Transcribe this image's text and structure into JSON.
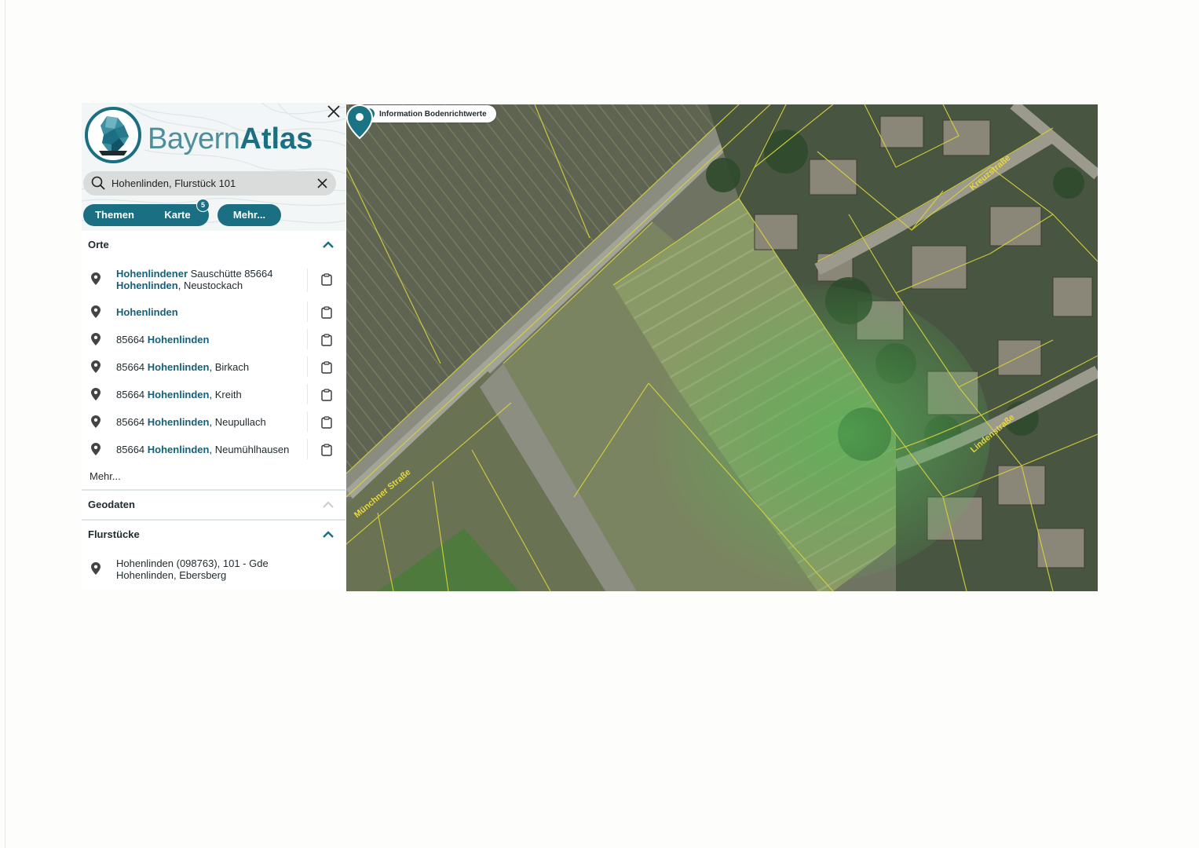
{
  "app": {
    "logo_light": "Bayern",
    "logo_bold": "Atlas"
  },
  "search": {
    "value": "Hohenlinden, Flurstück 101"
  },
  "tabs": [
    {
      "label": "Themen"
    },
    {
      "label": "Karte",
      "badge": "5"
    }
  ],
  "more_button": "Mehr...",
  "sections": {
    "orte": {
      "title": "Orte",
      "expanded": true,
      "results": [
        {
          "line1_bold": "Hohenlindener",
          "line1_rest": " Sauschütte 85664",
          "line2_bold": "Hohenlinden",
          "line2_rest": ", Neustockach"
        },
        {
          "prefix": "",
          "bold": "Hohenlinden",
          "rest": ""
        },
        {
          "prefix": "85664 ",
          "bold": "Hohenlinden",
          "rest": ""
        },
        {
          "prefix": "85664 ",
          "bold": "Hohenlinden",
          "rest": ", Birkach"
        },
        {
          "prefix": "85664 ",
          "bold": "Hohenlinden",
          "rest": ", Kreith"
        },
        {
          "prefix": "85664 ",
          "bold": "Hohenlinden",
          "rest": ", Neupullach"
        },
        {
          "prefix": "85664 ",
          "bold": "Hohenlinden",
          "rest": ", Neumühlhausen"
        }
      ],
      "more_link": "Mehr..."
    },
    "geodaten": {
      "title": "Geodaten",
      "expanded": false
    },
    "flurstuecke": {
      "title": "Flurstücke",
      "expanded": true,
      "results": [
        {
          "line1": "Hohenlinden (098763), 101 - Gde",
          "line2": "Hohenlinden, Ebersberg"
        }
      ]
    }
  },
  "map": {
    "info_chip": "Information Bodenrichtwerte",
    "info_icon": "info-icon",
    "streets": [
      "Münchner Straße",
      "Kreuzstraße",
      "Lindenstraße"
    ]
  },
  "colors": {
    "brand": "#1b6f82",
    "parcel_lines": "#d8d23a",
    "highlight_green": "#4fb04a"
  },
  "icons": [
    "close-icon",
    "search-icon",
    "clear-icon",
    "location-pin-icon",
    "clipboard-icon",
    "chevron-up-icon",
    "map-marker-icon"
  ]
}
